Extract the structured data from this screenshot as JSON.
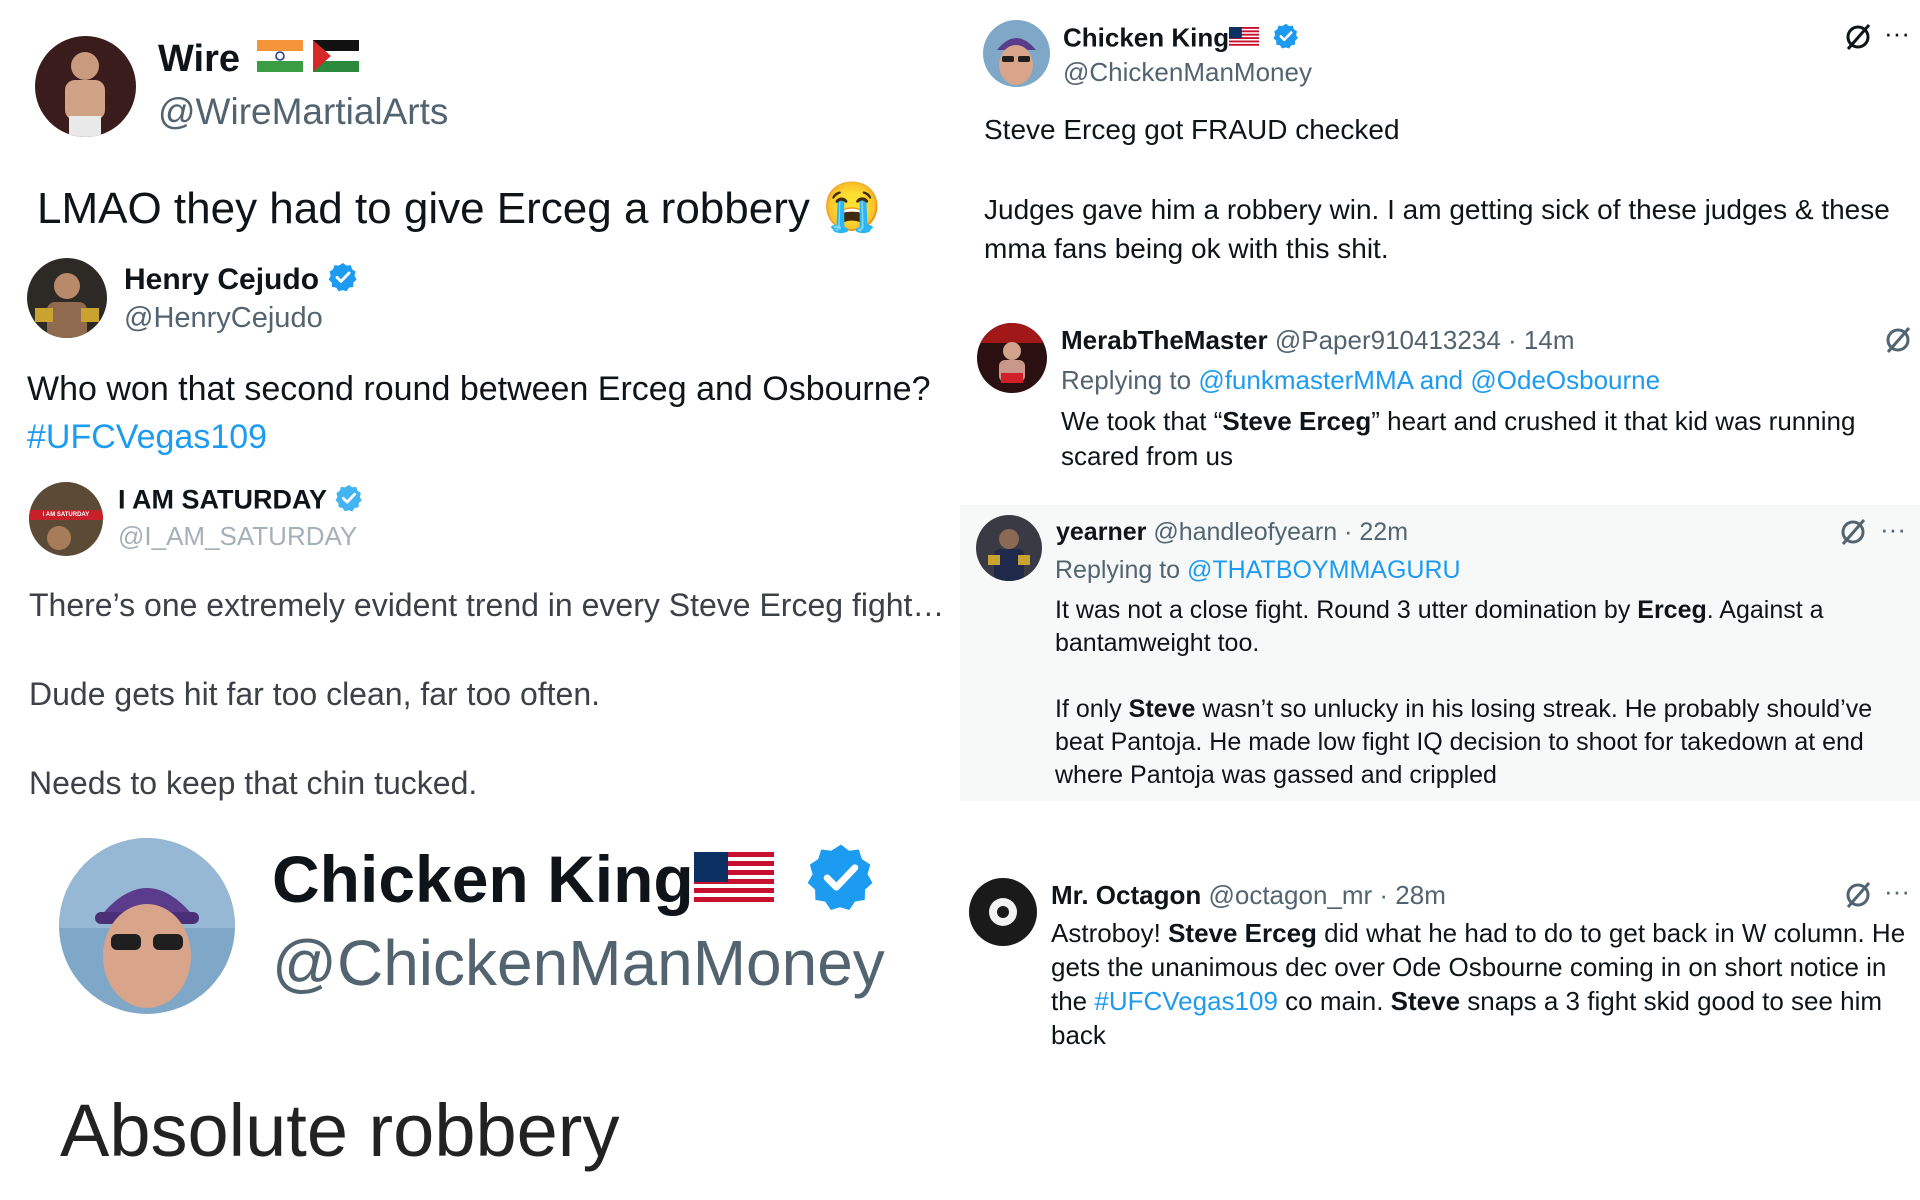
{
  "wire": {
    "name": "Wire",
    "handle": "@WireMartialArts",
    "text": "LMAO they had to give Erceg a robbery",
    "emoji": "😭"
  },
  "cejudo": {
    "name": "Henry Cejudo",
    "handle": "@HenryCejudo",
    "text": "Who won that second round between Erceg and Osbourne?",
    "hashtag": "#UFCVegas109"
  },
  "saturday": {
    "name": "I AM SATURDAY",
    "handle": "@I_AM_SATURDAY",
    "avatar_label": "I AM SATURDAY",
    "line1": "There’s one extremely evident trend in every Steve Erceg fight…",
    "line2": "Dude gets hit far too clean, far too often.",
    "line3": "Needs to keep that chin tucked."
  },
  "chicken_big": {
    "name": "Chicken King",
    "handle": "@ChickenManMoney",
    "text": "Absolute robbery"
  },
  "chicken_top": {
    "name": "Chicken King",
    "handle": "@ChickenManMoney",
    "line1": "Steve Erceg got FRAUD checked",
    "line2": "Judges gave him a robbery win. I am getting sick of these judges & these",
    "line3": "mma fans being ok with this shit."
  },
  "merab": {
    "name": "MerabTheMaster",
    "handle": "@Paper910413234",
    "time": "· 14m",
    "replying_prefix": "Replying to",
    "replying_to": "@funkmasterMMA and @OdeOsbourne",
    "l1_a": "We took that “",
    "l1_bold": "Steve Erceg",
    "l1_b": "” heart and crushed it that kid was running",
    "line2": "scared from us"
  },
  "yearner": {
    "name": "yearner",
    "handle": "@handleofyearn",
    "time": "· 22m",
    "replying_prefix": "Replying to",
    "replying_to": "@THATBOYMMAGURU",
    "p1_a": "It was not a close fight. Round 3 utter domination by ",
    "p1_bold": "Erceg",
    "p1_b": ". Against a",
    "p1_line2": "bantamweight too.",
    "p2_a": "If only ",
    "p2_bold": "Steve",
    "p2_b": " wasn’t so unlucky in his losing streak. He probably should’ve",
    "p2_line2": "beat Pantoja. He made low fight IQ decision to shoot for takedown at end",
    "p2_line3": "where Pantoja was gassed and crippled",
    "more": "···"
  },
  "octagon": {
    "name": "Mr. Octagon",
    "handle": "@octagon_mr",
    "time": "· 28m",
    "l1_a": "Astroboy! ",
    "l1_bold": "Steve Erceg",
    "l1_b": " did what he had to do to get back in W column. He",
    "line2": "gets the unanimous dec over Ode Osbourne coming in on short notice in",
    "l3_a": "the ",
    "l3_link": "#UFCVegas109",
    "l3_b": " co main. ",
    "l3_bold": "Steve",
    "l3_c": " snaps a 3 fight skid good to see him",
    "line4": "back",
    "more": "···"
  },
  "chicken_top_more": "···",
  "colors": {
    "verified": "#1d9bf0",
    "link": "#1d9bf0",
    "handle": "#536471",
    "text": "#0f1419"
  }
}
